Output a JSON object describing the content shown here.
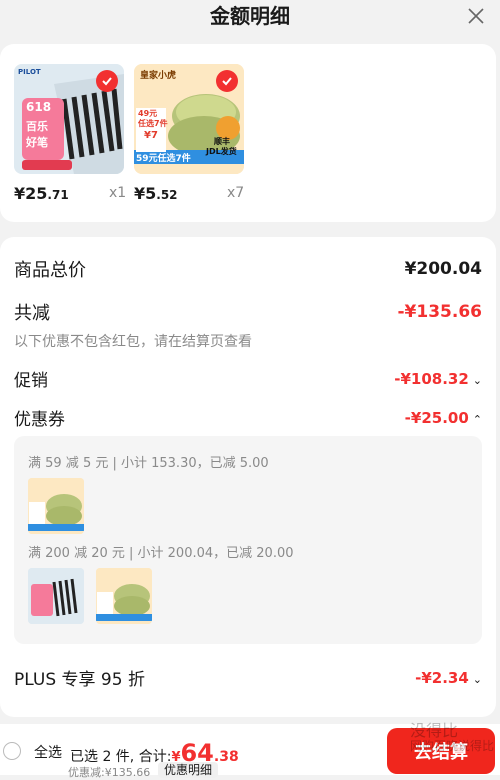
{
  "header": {
    "title": "金额明细"
  },
  "products": [
    {
      "price_int": "¥25",
      "price_dec": ".71",
      "qty": "x1"
    },
    {
      "price_int": "¥5",
      "price_dec": ".52",
      "qty": "x7"
    }
  ],
  "summary": {
    "total_label": "商品总价",
    "total_value": "¥200.04",
    "reduce_label": "共减",
    "reduce_value": "-¥135.66",
    "note": "以下优惠不包含红包，请在结算页查看",
    "promo_label": "促销",
    "promo_value": "-¥108.32",
    "coupon_label": "优惠券",
    "coupon_value": "-¥25.00",
    "coupon_rules": [
      "满 59 减 5 元 | 小计 153.30，已减 5.00",
      "满 200 减 20 元 | 小计 200.04，已减 20.00"
    ],
    "plus_label": "PLUS 专享 95 折",
    "plus_value": "-¥2.34"
  },
  "bottom": {
    "select_all": "全选",
    "selected_text": "已选 2 件, 合计:",
    "total_sym": "¥",
    "total_int": "64",
    "total_dec": ".38",
    "discount_text": "优惠减:¥135.66",
    "detail_btn": "优惠明细",
    "checkout": "去结算"
  },
  "thumb_text": {
    "brand_a": "PILOT",
    "promo_a1": "618",
    "promo_a2": "百乐",
    "promo_a3": "好笔",
    "brand_b": "皇家小虎",
    "promo_b1": "49元",
    "promo_b2": "任选7件",
    "promo_b3": "59元任选7件",
    "promo_b4": "顺丰",
    "promo_b5": "JDL发货",
    "price_tag": "¥7"
  },
  "watermark": {
    "line1": "没得比",
    "line2": "网购百晓说得比"
  },
  "colors": {
    "accent": "#f23030",
    "checkout": "#f0261d"
  }
}
